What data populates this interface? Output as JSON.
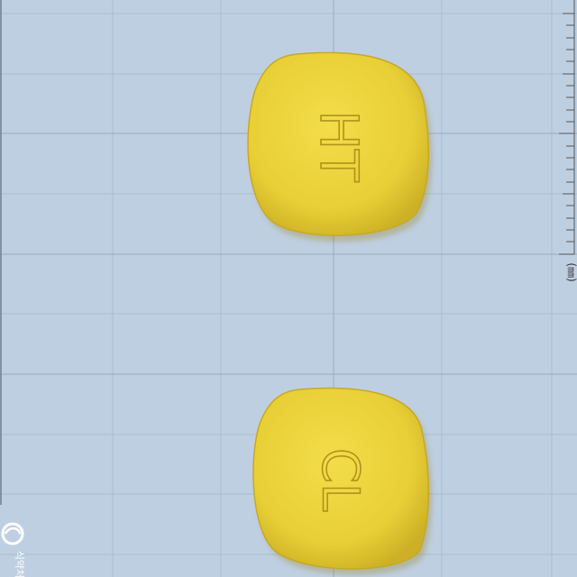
{
  "photo": {
    "background_color": "#bfcfe2",
    "grid_line_color": "#9fb2c8",
    "pill_color": "#ecd43a",
    "pill_shadow_color": "#c9ad22",
    "tablets": [
      {
        "side": "front",
        "imprint": "HT"
      },
      {
        "side": "back",
        "imprint": "CL"
      }
    ],
    "ruler": {
      "unit_label": "(㎜)"
    },
    "watermark": {
      "text": "식약처"
    }
  }
}
